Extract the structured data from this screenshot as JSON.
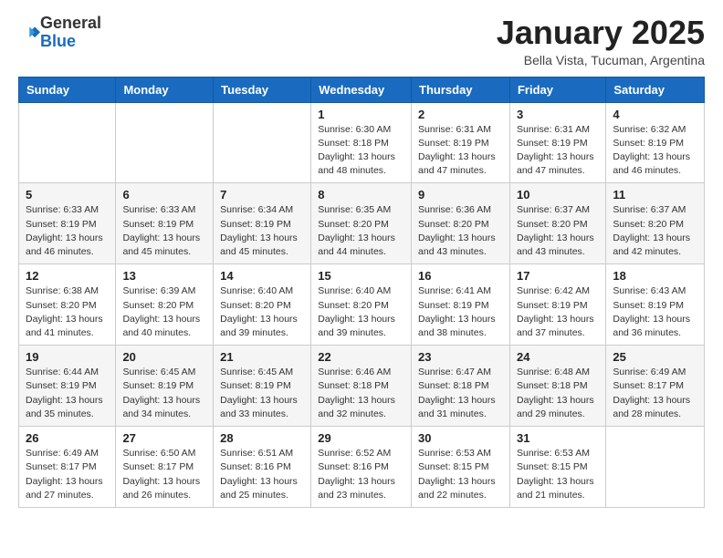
{
  "header": {
    "logo_general": "General",
    "logo_blue": "Blue",
    "month_title": "January 2025",
    "location": "Bella Vista, Tucuman, Argentina"
  },
  "days_of_week": [
    "Sunday",
    "Monday",
    "Tuesday",
    "Wednesday",
    "Thursday",
    "Friday",
    "Saturday"
  ],
  "weeks": [
    [
      {
        "day": "",
        "info": ""
      },
      {
        "day": "",
        "info": ""
      },
      {
        "day": "",
        "info": ""
      },
      {
        "day": "1",
        "info": "Sunrise: 6:30 AM\nSunset: 8:18 PM\nDaylight: 13 hours\nand 48 minutes."
      },
      {
        "day": "2",
        "info": "Sunrise: 6:31 AM\nSunset: 8:19 PM\nDaylight: 13 hours\nand 47 minutes."
      },
      {
        "day": "3",
        "info": "Sunrise: 6:31 AM\nSunset: 8:19 PM\nDaylight: 13 hours\nand 47 minutes."
      },
      {
        "day": "4",
        "info": "Sunrise: 6:32 AM\nSunset: 8:19 PM\nDaylight: 13 hours\nand 46 minutes."
      }
    ],
    [
      {
        "day": "5",
        "info": "Sunrise: 6:33 AM\nSunset: 8:19 PM\nDaylight: 13 hours\nand 46 minutes."
      },
      {
        "day": "6",
        "info": "Sunrise: 6:33 AM\nSunset: 8:19 PM\nDaylight: 13 hours\nand 45 minutes."
      },
      {
        "day": "7",
        "info": "Sunrise: 6:34 AM\nSunset: 8:19 PM\nDaylight: 13 hours\nand 45 minutes."
      },
      {
        "day": "8",
        "info": "Sunrise: 6:35 AM\nSunset: 8:20 PM\nDaylight: 13 hours\nand 44 minutes."
      },
      {
        "day": "9",
        "info": "Sunrise: 6:36 AM\nSunset: 8:20 PM\nDaylight: 13 hours\nand 43 minutes."
      },
      {
        "day": "10",
        "info": "Sunrise: 6:37 AM\nSunset: 8:20 PM\nDaylight: 13 hours\nand 43 minutes."
      },
      {
        "day": "11",
        "info": "Sunrise: 6:37 AM\nSunset: 8:20 PM\nDaylight: 13 hours\nand 42 minutes."
      }
    ],
    [
      {
        "day": "12",
        "info": "Sunrise: 6:38 AM\nSunset: 8:20 PM\nDaylight: 13 hours\nand 41 minutes."
      },
      {
        "day": "13",
        "info": "Sunrise: 6:39 AM\nSunset: 8:20 PM\nDaylight: 13 hours\nand 40 minutes."
      },
      {
        "day": "14",
        "info": "Sunrise: 6:40 AM\nSunset: 8:20 PM\nDaylight: 13 hours\nand 39 minutes."
      },
      {
        "day": "15",
        "info": "Sunrise: 6:40 AM\nSunset: 8:20 PM\nDaylight: 13 hours\nand 39 minutes."
      },
      {
        "day": "16",
        "info": "Sunrise: 6:41 AM\nSunset: 8:19 PM\nDaylight: 13 hours\nand 38 minutes."
      },
      {
        "day": "17",
        "info": "Sunrise: 6:42 AM\nSunset: 8:19 PM\nDaylight: 13 hours\nand 37 minutes."
      },
      {
        "day": "18",
        "info": "Sunrise: 6:43 AM\nSunset: 8:19 PM\nDaylight: 13 hours\nand 36 minutes."
      }
    ],
    [
      {
        "day": "19",
        "info": "Sunrise: 6:44 AM\nSunset: 8:19 PM\nDaylight: 13 hours\nand 35 minutes."
      },
      {
        "day": "20",
        "info": "Sunrise: 6:45 AM\nSunset: 8:19 PM\nDaylight: 13 hours\nand 34 minutes."
      },
      {
        "day": "21",
        "info": "Sunrise: 6:45 AM\nSunset: 8:19 PM\nDaylight: 13 hours\nand 33 minutes."
      },
      {
        "day": "22",
        "info": "Sunrise: 6:46 AM\nSunset: 8:18 PM\nDaylight: 13 hours\nand 32 minutes."
      },
      {
        "day": "23",
        "info": "Sunrise: 6:47 AM\nSunset: 8:18 PM\nDaylight: 13 hours\nand 31 minutes."
      },
      {
        "day": "24",
        "info": "Sunrise: 6:48 AM\nSunset: 8:18 PM\nDaylight: 13 hours\nand 29 minutes."
      },
      {
        "day": "25",
        "info": "Sunrise: 6:49 AM\nSunset: 8:17 PM\nDaylight: 13 hours\nand 28 minutes."
      }
    ],
    [
      {
        "day": "26",
        "info": "Sunrise: 6:49 AM\nSunset: 8:17 PM\nDaylight: 13 hours\nand 27 minutes."
      },
      {
        "day": "27",
        "info": "Sunrise: 6:50 AM\nSunset: 8:17 PM\nDaylight: 13 hours\nand 26 minutes."
      },
      {
        "day": "28",
        "info": "Sunrise: 6:51 AM\nSunset: 8:16 PM\nDaylight: 13 hours\nand 25 minutes."
      },
      {
        "day": "29",
        "info": "Sunrise: 6:52 AM\nSunset: 8:16 PM\nDaylight: 13 hours\nand 23 minutes."
      },
      {
        "day": "30",
        "info": "Sunrise: 6:53 AM\nSunset: 8:15 PM\nDaylight: 13 hours\nand 22 minutes."
      },
      {
        "day": "31",
        "info": "Sunrise: 6:53 AM\nSunset: 8:15 PM\nDaylight: 13 hours\nand 21 minutes."
      },
      {
        "day": "",
        "info": ""
      }
    ]
  ]
}
